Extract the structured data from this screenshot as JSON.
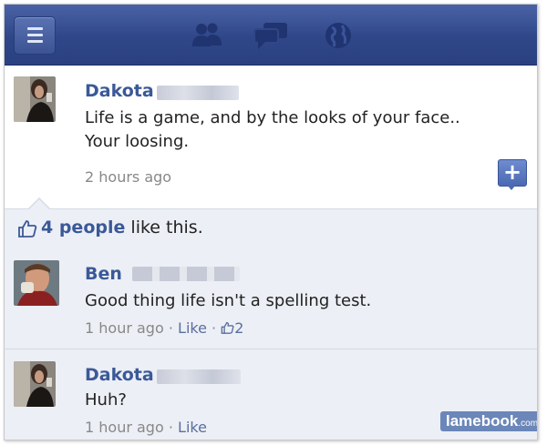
{
  "topbar": {
    "icons": [
      "menu-icon",
      "friends-icon",
      "messages-icon",
      "globe-icon"
    ]
  },
  "post": {
    "author": "Dakota",
    "lines": [
      "Life is a game, and by the looks of your face..",
      "Your loosing."
    ],
    "time": "2 hours ago",
    "add_label": "+"
  },
  "likes": {
    "count": "4 people",
    "suffix": "like this."
  },
  "comments": [
    {
      "author": "Ben",
      "text": "Good thing life isn't a spelling test.",
      "time": "1 hour ago",
      "sep1": "·",
      "like_label": "Like",
      "sep2": "·",
      "like_count": "2"
    },
    {
      "author": "Dakota",
      "text": "Huh?",
      "time": "1 hour ago",
      "sep1": "·",
      "like_label": "Like"
    }
  ],
  "watermark": {
    "brand": "lamebook",
    "tld": ".com"
  },
  "colors": {
    "brand_blue": "#3b5998",
    "bar_blue": "#2f4788",
    "comment_bg": "#eceff5"
  }
}
